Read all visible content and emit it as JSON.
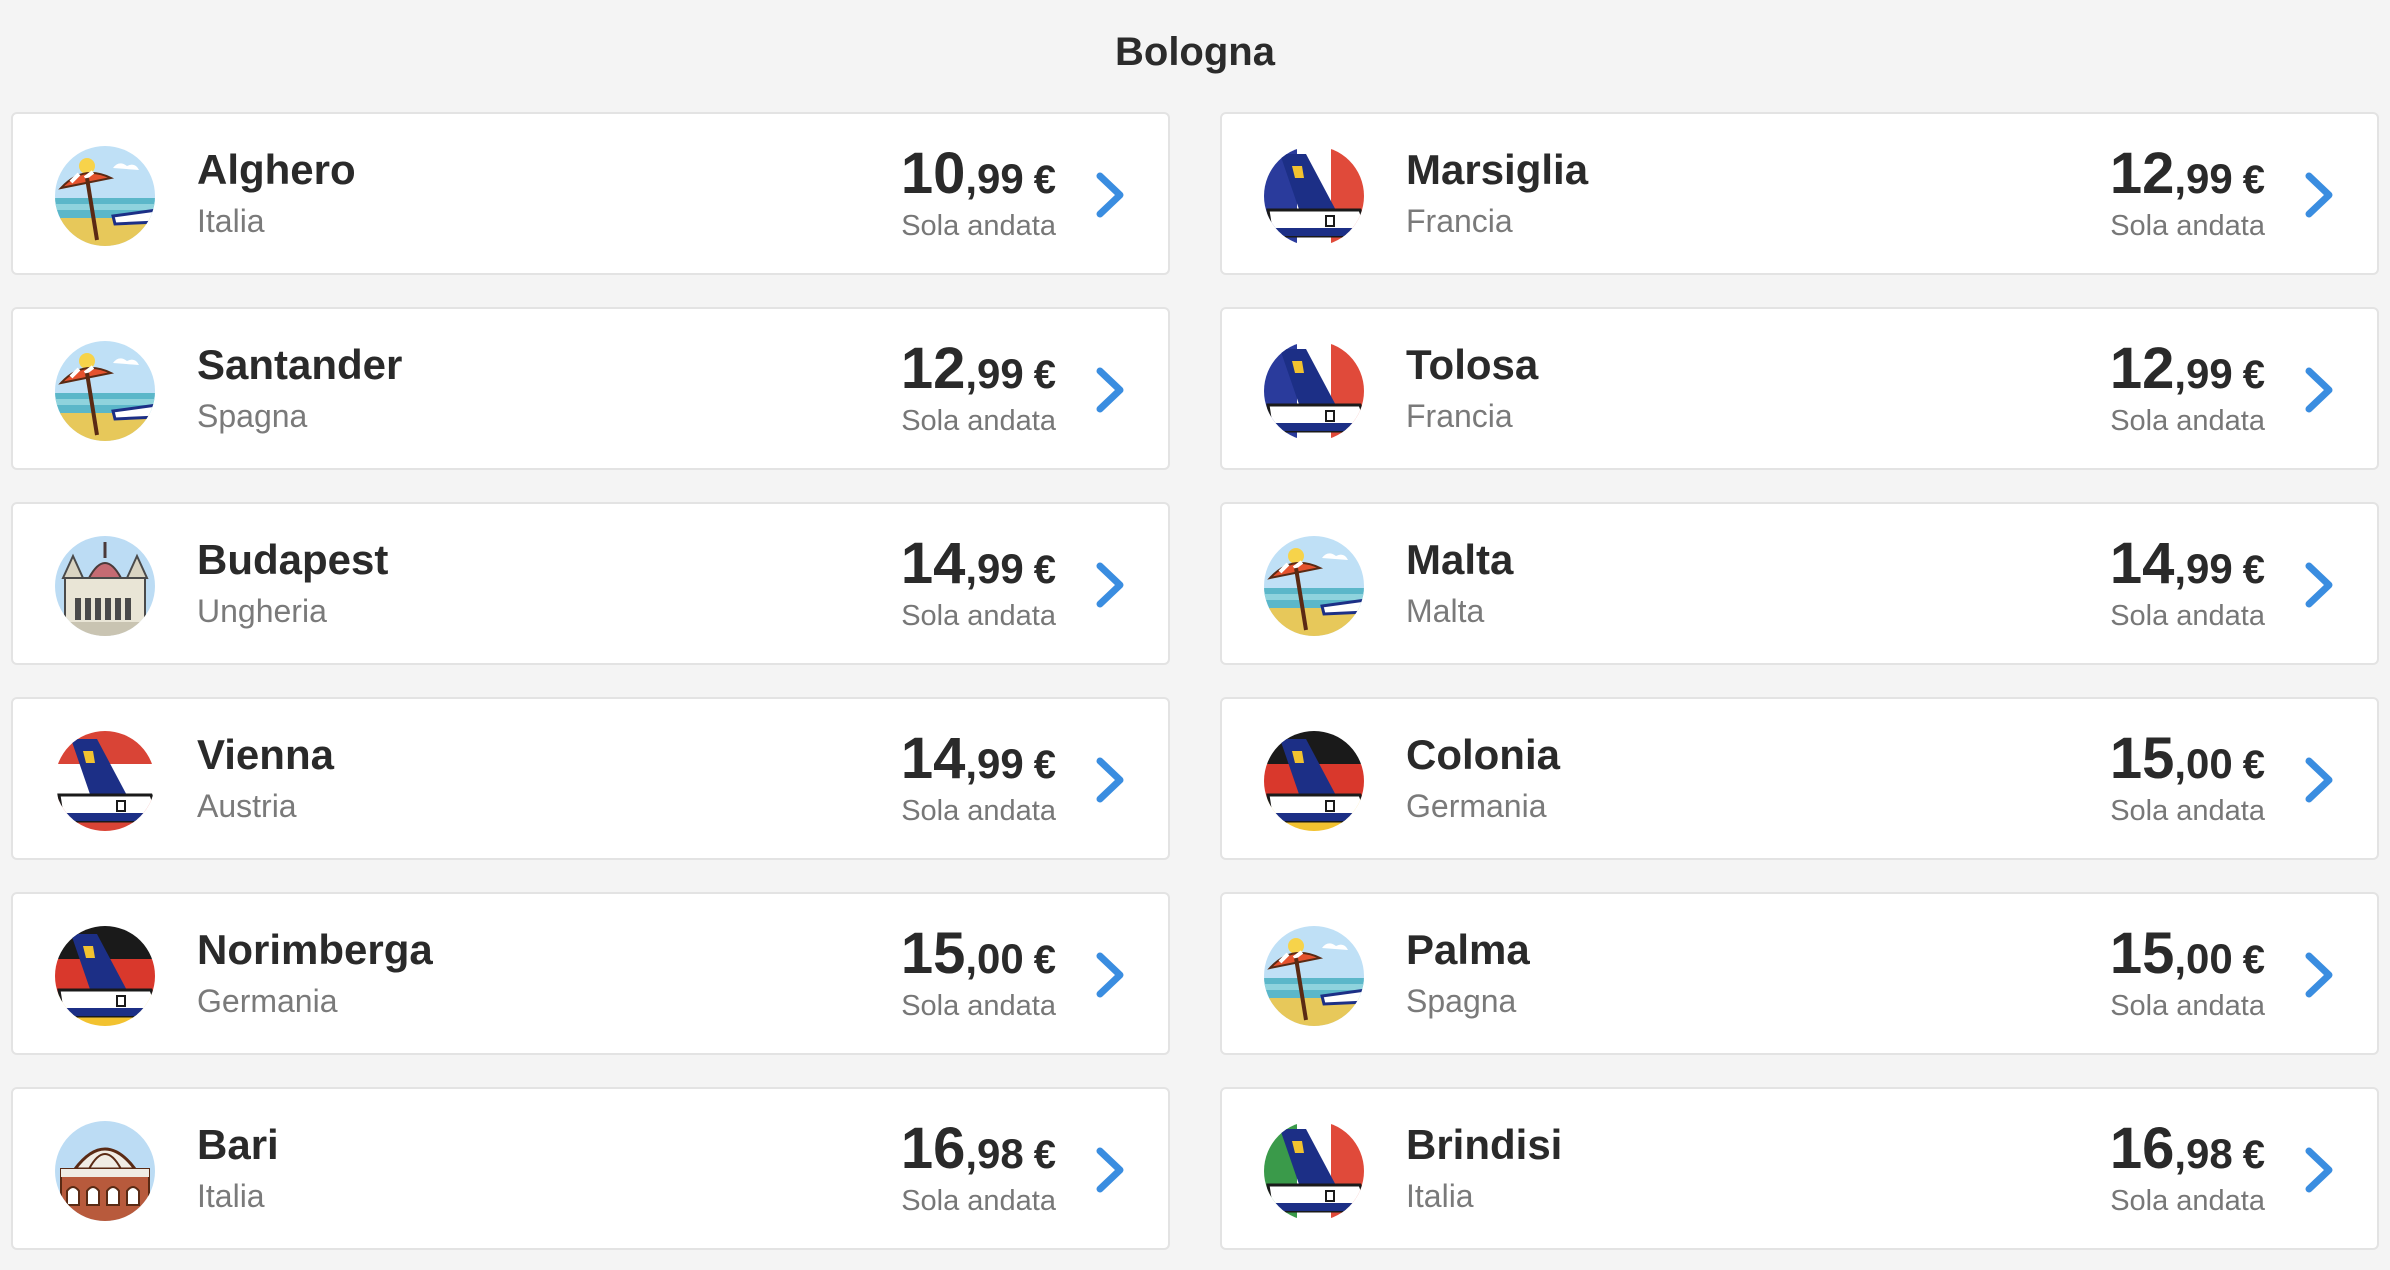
{
  "page": {
    "title": "Bologna"
  },
  "colors": {
    "accent": "#3a8de0",
    "text": "#2a2a2a",
    "muted": "#7a7a7a"
  },
  "destinations": [
    {
      "city": "Alghero",
      "country": "Italia",
      "price_int": "10",
      "price_dec": ",99",
      "currency": "€",
      "trip": "Sola andata",
      "icon": "beach-icon"
    },
    {
      "city": "Marsiglia",
      "country": "Francia",
      "price_int": "12",
      "price_dec": ",99",
      "currency": "€",
      "trip": "Sola andata",
      "icon": "plane-tail-france-icon"
    },
    {
      "city": "Santander",
      "country": "Spagna",
      "price_int": "12",
      "price_dec": ",99",
      "currency": "€",
      "trip": "Sola andata",
      "icon": "beach-icon"
    },
    {
      "city": "Tolosa",
      "country": "Francia",
      "price_int": "12",
      "price_dec": ",99",
      "currency": "€",
      "trip": "Sola andata",
      "icon": "plane-tail-france-icon"
    },
    {
      "city": "Budapest",
      "country": "Ungheria",
      "price_int": "14",
      "price_dec": ",99",
      "currency": "€",
      "trip": "Sola andata",
      "icon": "parliament-icon"
    },
    {
      "city": "Malta",
      "country": "Malta",
      "price_int": "14",
      "price_dec": ",99",
      "currency": "€",
      "trip": "Sola andata",
      "icon": "beach-icon"
    },
    {
      "city": "Vienna",
      "country": "Austria",
      "price_int": "14",
      "price_dec": ",99",
      "currency": "€",
      "trip": "Sola andata",
      "icon": "plane-tail-austria-icon"
    },
    {
      "city": "Colonia",
      "country": "Germania",
      "price_int": "15",
      "price_dec": ",00",
      "currency": "€",
      "trip": "Sola andata",
      "icon": "plane-tail-germany-icon"
    },
    {
      "city": "Norimberga",
      "country": "Germania",
      "price_int": "15",
      "price_dec": ",00",
      "currency": "€",
      "trip": "Sola andata",
      "icon": "plane-tail-germany-icon"
    },
    {
      "city": "Palma",
      "country": "Spagna",
      "price_int": "15",
      "price_dec": ",00",
      "currency": "€",
      "trip": "Sola andata",
      "icon": "beach-icon"
    },
    {
      "city": "Bari",
      "country": "Italia",
      "price_int": "16",
      "price_dec": ",98",
      "currency": "€",
      "trip": "Sola andata",
      "icon": "cathedral-dome-icon"
    },
    {
      "city": "Brindisi",
      "country": "Italia",
      "price_int": "16",
      "price_dec": ",98",
      "currency": "€",
      "trip": "Sola andata",
      "icon": "plane-tail-italy-icon"
    }
  ]
}
